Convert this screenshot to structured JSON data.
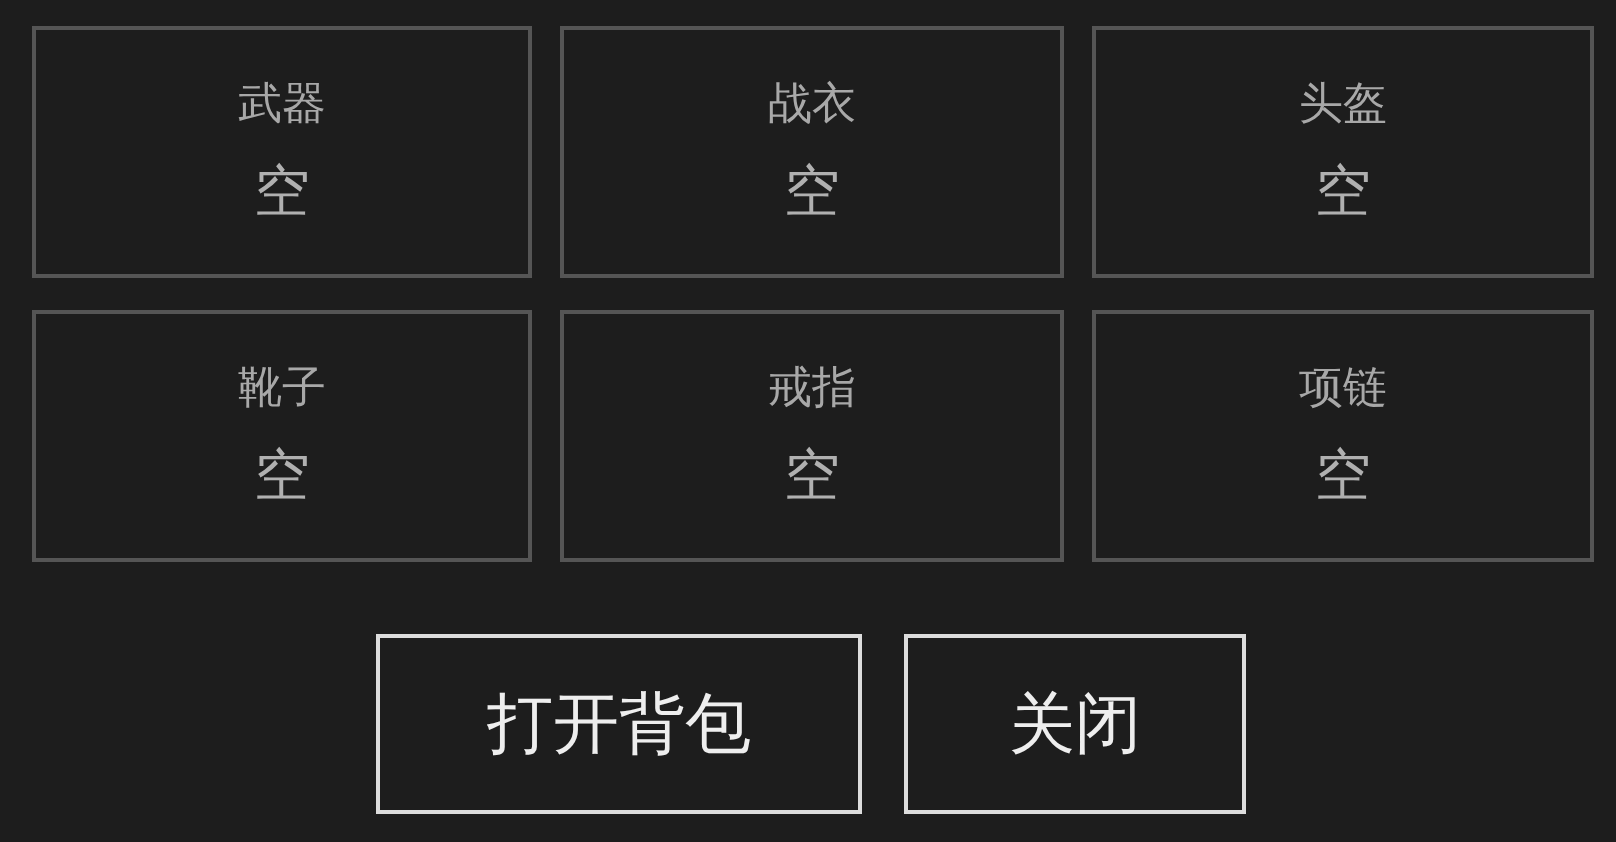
{
  "slots": [
    {
      "label": "武器",
      "value": "空"
    },
    {
      "label": "战衣",
      "value": "空"
    },
    {
      "label": "头盔",
      "value": "空"
    },
    {
      "label": "靴子",
      "value": "空"
    },
    {
      "label": "戒指",
      "value": "空"
    },
    {
      "label": "项链",
      "value": "空"
    }
  ],
  "buttons": [
    {
      "label": "打开背包",
      "kind": "open"
    },
    {
      "label": "关闭",
      "kind": "close"
    }
  ]
}
